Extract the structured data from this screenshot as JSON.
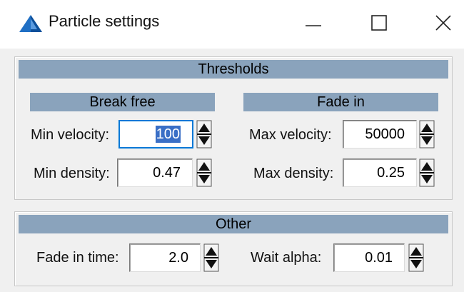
{
  "window": {
    "title": "Particle settings",
    "icon": "triangle-app-icon",
    "controls": [
      "minimize-icon",
      "maximize-icon",
      "close-icon"
    ]
  },
  "thresholds": {
    "title": "Thresholds",
    "break_free": {
      "title": "Break free",
      "min_velocity_label": "Min velocity:",
      "min_velocity_value": "100",
      "min_density_label": "Min density:",
      "min_density_value": "0.47"
    },
    "fade_in": {
      "title": "Fade in",
      "max_velocity_label": "Max velocity:",
      "max_velocity_value": "50000",
      "max_density_label": "Max density:",
      "max_density_value": "0.25"
    }
  },
  "other": {
    "title": "Other",
    "fade_in_time_label": "Fade in time:",
    "fade_in_time_value": "2.0",
    "wait_alpha_label": "Wait alpha:",
    "wait_alpha_value": "0.01"
  },
  "colors": {
    "banner": "#8aa3bc",
    "focus": "#0078d7",
    "selection": "#3a6fc6",
    "dialog": "#f0f0f0"
  }
}
